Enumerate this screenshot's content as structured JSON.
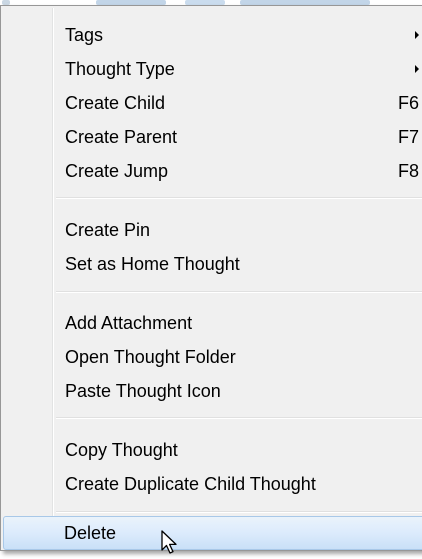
{
  "colors": {
    "menu_background": "#f0f0f0",
    "highlight": "#c9e0f7",
    "border": "#979797"
  },
  "menu": {
    "groups": [
      [
        {
          "label": "Tags",
          "submenu": true
        },
        {
          "label": "Thought Type",
          "submenu": true
        },
        {
          "label": "Create Child",
          "shortcut": "F6"
        },
        {
          "label": "Create Parent",
          "shortcut": "F7"
        },
        {
          "label": "Create Jump",
          "shortcut": "F8"
        }
      ],
      [
        {
          "label": "Create Pin"
        },
        {
          "label": "Set as Home Thought"
        }
      ],
      [
        {
          "label": "Add Attachment"
        },
        {
          "label": "Open Thought Folder"
        },
        {
          "label": "Paste Thought Icon"
        }
      ],
      [
        {
          "label": "Copy Thought"
        },
        {
          "label": "Create Duplicate Child Thought"
        }
      ],
      [
        {
          "label": "Delete",
          "highlighted": true
        }
      ]
    ]
  },
  "icons": {
    "submenu_arrow": "chevron-right-icon",
    "cursor": "mouse-pointer-icon"
  }
}
